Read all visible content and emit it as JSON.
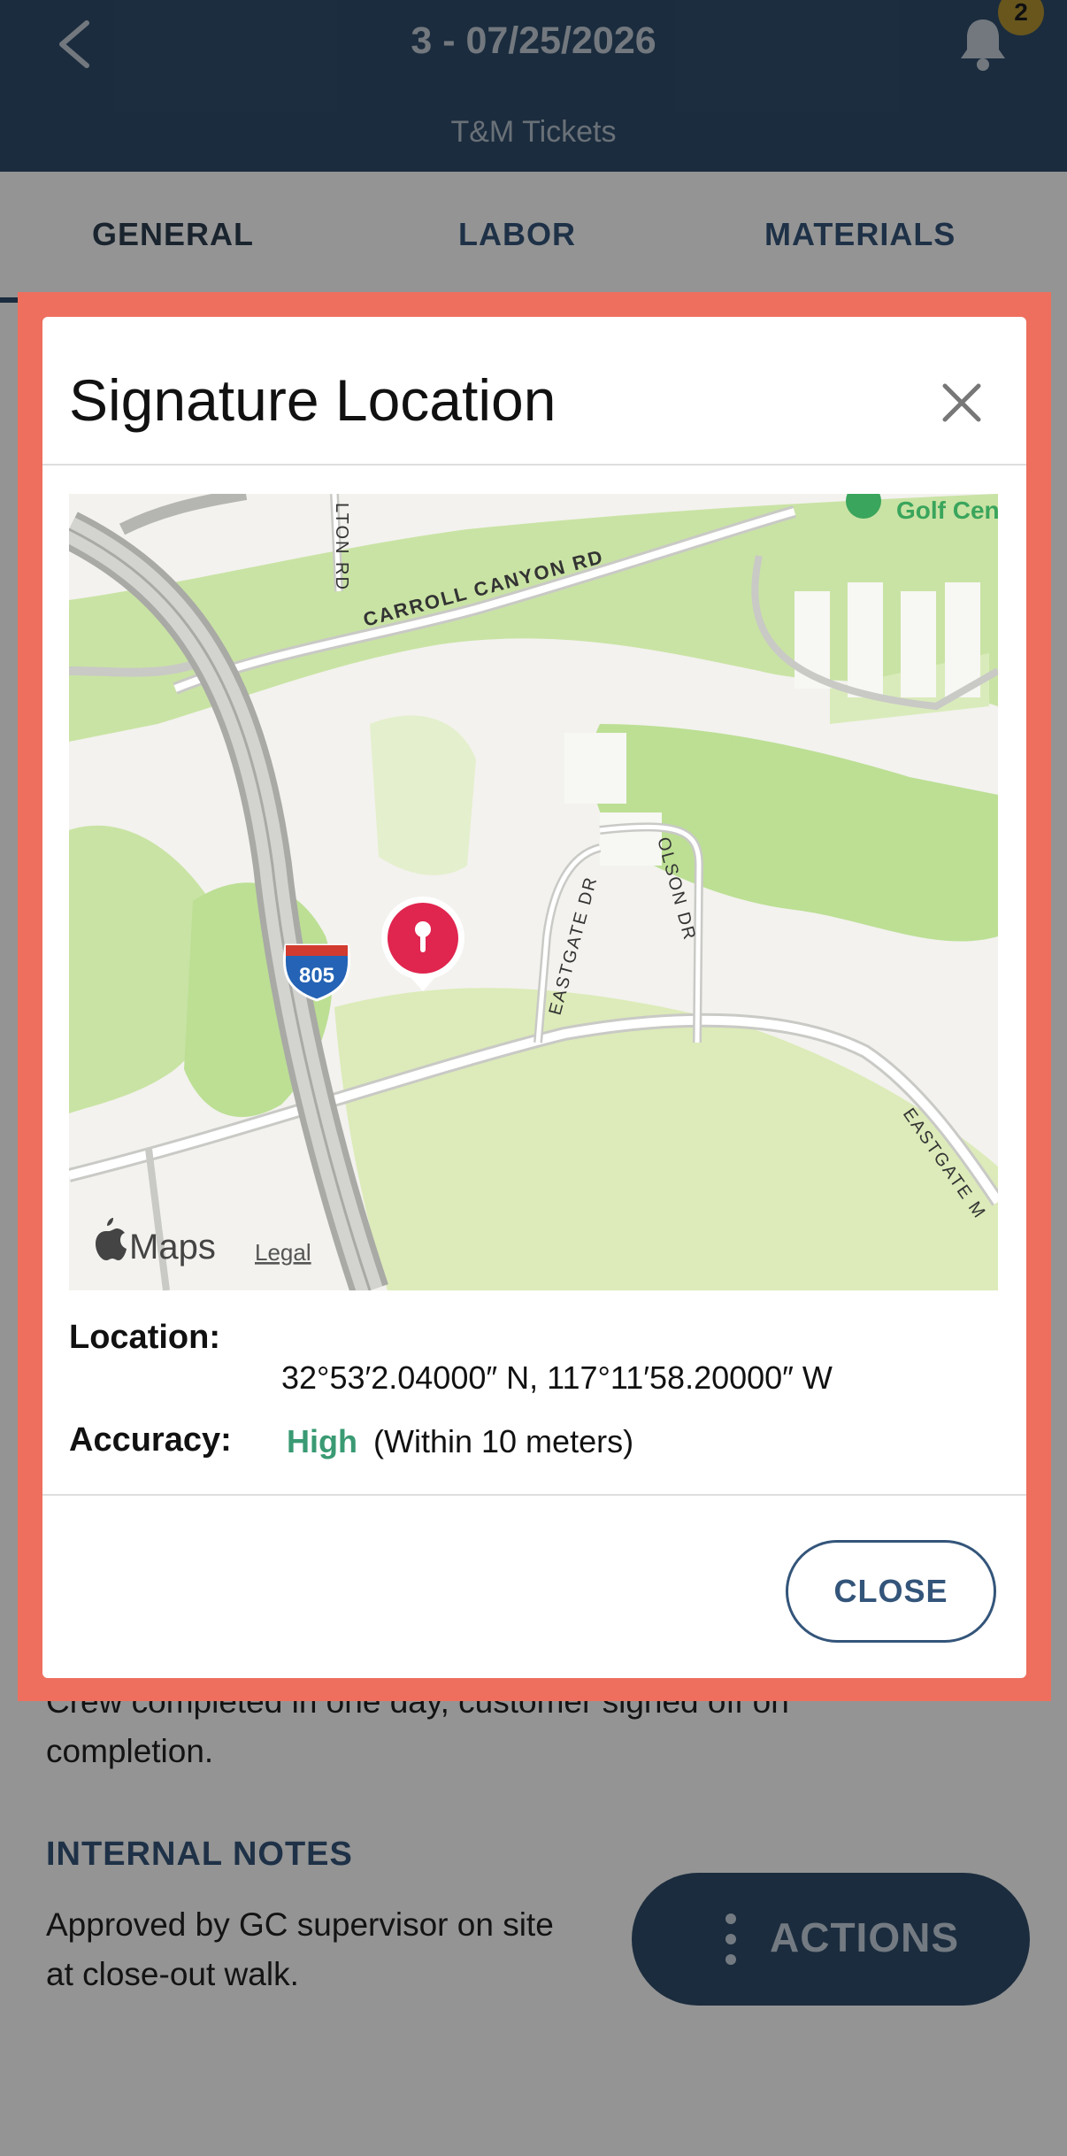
{
  "header": {
    "title": "3 - 07/25/2026",
    "subtitle": "T&M Tickets",
    "notification_count": "2"
  },
  "tabs": [
    {
      "label": "GENERAL",
      "active": true
    },
    {
      "label": "LABOR",
      "active": false
    },
    {
      "label": "MATERIALS",
      "active": false
    }
  ],
  "content": {
    "notes_line1": "Crew completed in one day, customer signed off on",
    "notes_line2": "completion.",
    "internal_notes_title": "INTERNAL NOTES",
    "internal_line1": "Approved by GC supervisor on site",
    "internal_line2": "at close-out walk."
  },
  "actions_button": {
    "label": "ACTIONS"
  },
  "modal": {
    "title": "Signature Location",
    "map": {
      "streets": [
        "CARROLL CANYON RD",
        "EASTGATE DR",
        "OLSON DR",
        "EASTGATE M",
        "LTON RD"
      ],
      "highway_shield": "805",
      "poi": "Golf Cen",
      "attribution": "Maps",
      "legal_link": "Legal"
    },
    "location_label": "Location:",
    "location_value": "32°53′2.04000″ N, 117°11′58.20000″ W",
    "accuracy_label": "Accuracy:",
    "accuracy_level": "High",
    "accuracy_detail": "(Within 10 meters)",
    "close_button": "CLOSE"
  },
  "colors": {
    "header_bg": "#2f4d6b",
    "highlight_border": "#ee6f5e",
    "accuracy_high": "#3a9a73",
    "accent": "#34557a",
    "badge": "#b49433"
  },
  "icons": [
    "back-icon",
    "bell-icon",
    "close-icon",
    "location-pin-icon",
    "apple-logo-icon",
    "more-vertical-icon"
  ]
}
